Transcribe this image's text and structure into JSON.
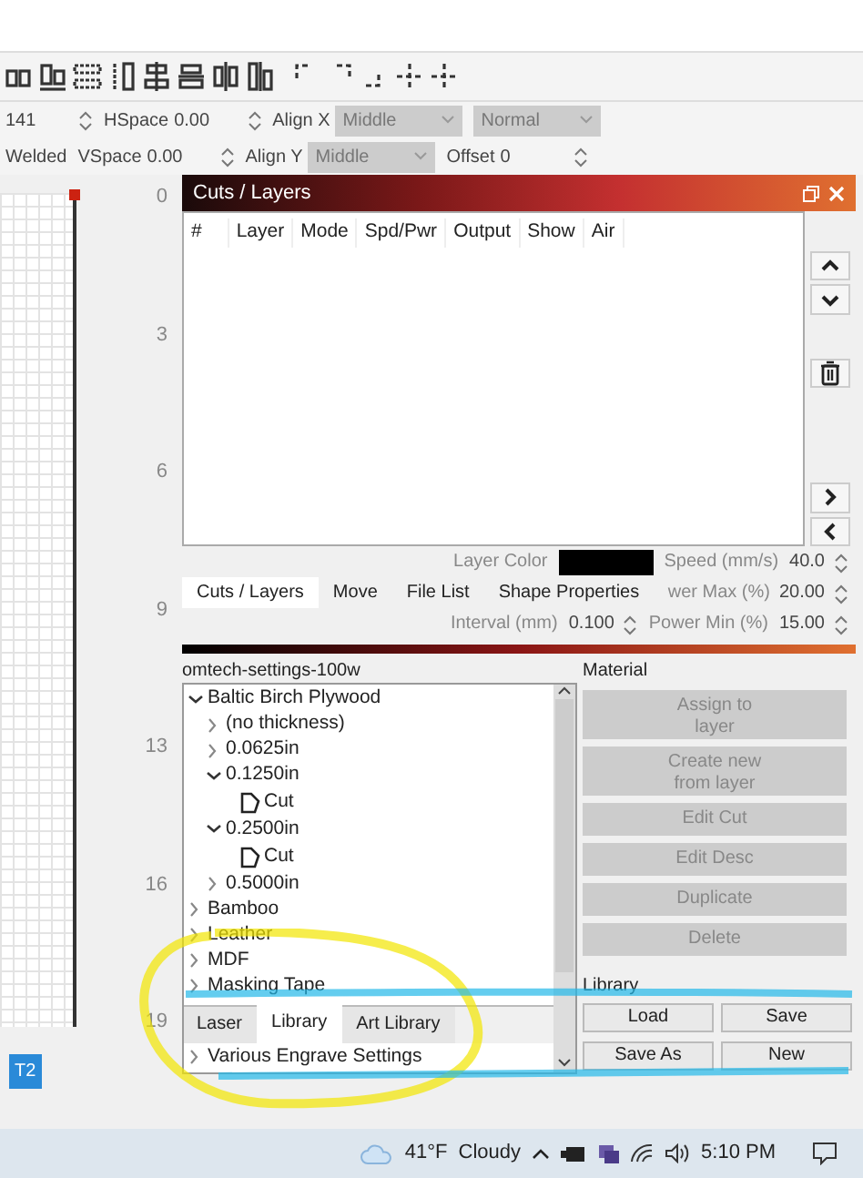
{
  "property_rows": [
    [
      {
        "kind": "spin",
        "value": "141"
      },
      {
        "kind": "spin",
        "label": "HSpace",
        "value": "0.00"
      },
      {
        "kind": "select",
        "label": "Align X",
        "value": "Middle",
        "disabled": true
      },
      {
        "kind": "select",
        "value": "Normal",
        "disabled": true
      }
    ],
    [
      {
        "kind": "text",
        "value": "Welded"
      },
      {
        "kind": "spin",
        "label": "VSpace",
        "value": "0.00"
      },
      {
        "kind": "select",
        "label": "Align Y",
        "value": "Middle",
        "disabled": true
      },
      {
        "kind": "spin",
        "label": "Offset",
        "value": "0"
      }
    ]
  ],
  "ruler": {
    "marks": [
      "0",
      "3",
      "6",
      "9",
      "13",
      "16",
      "19"
    ]
  },
  "canvas_tag": "T2",
  "cuts_layers": {
    "title": "Cuts / Layers",
    "columns": [
      "#",
      "Layer",
      "Mode",
      "Spd/Pwr",
      "Output",
      "Show",
      "Air"
    ],
    "layer_color_label": "Layer Color",
    "speed": {
      "label": "Speed (mm/s)",
      "value": "40.0"
    },
    "power_max": {
      "label": "wer Max (%)",
      "value": "20.00"
    },
    "interval": {
      "label": "Interval (mm)",
      "value": "0.100"
    },
    "power_min": {
      "label": "Power Min (%)",
      "value": "15.00"
    },
    "tabs": [
      {
        "label": "Cuts / Layers",
        "selected": true
      },
      {
        "label": "Move",
        "selected": false
      },
      {
        "label": "File List",
        "selected": false
      },
      {
        "label": "Shape Properties",
        "selected": false
      }
    ]
  },
  "library": {
    "file": "omtech-settings-100w",
    "tree": [
      {
        "kind": "group",
        "label": "Baltic Birch Plywood",
        "expanded": true,
        "children": [
          {
            "kind": "group",
            "label": "(no thickness)",
            "expanded": false
          },
          {
            "kind": "group",
            "label": "0.0625in",
            "expanded": false
          },
          {
            "kind": "group",
            "label": "0.1250in",
            "expanded": true,
            "children": [
              {
                "kind": "entry",
                "label": "Cut"
              }
            ]
          },
          {
            "kind": "group",
            "label": "0.2500in",
            "expanded": true,
            "children": [
              {
                "kind": "entry",
                "label": "Cut"
              }
            ]
          },
          {
            "kind": "group",
            "label": "0.5000in",
            "expanded": false
          }
        ]
      },
      {
        "kind": "group",
        "label": "Bamboo",
        "expanded": false
      },
      {
        "kind": "group",
        "label": "Leather",
        "expanded": false
      },
      {
        "kind": "group",
        "label": "MDF",
        "expanded": false
      },
      {
        "kind": "group",
        "label": "Masking Tape",
        "expanded": false
      },
      {
        "kind": "group",
        "label": "Various Engrave Settings",
        "expanded": false
      }
    ],
    "material": {
      "title": "Material",
      "buttons": [
        {
          "label": "Assign to layer",
          "disabled": true
        },
        {
          "label": "Create new from layer",
          "disabled": true
        },
        {
          "label": "Edit Cut",
          "disabled": true
        },
        {
          "label": "Edit Desc",
          "disabled": true
        },
        {
          "label": "Duplicate",
          "disabled": true
        },
        {
          "label": "Delete",
          "disabled": true
        }
      ]
    },
    "library_box": {
      "title": "Library",
      "buttons": [
        {
          "label": "Load",
          "disabled": false
        },
        {
          "label": "Save",
          "disabled": false
        },
        {
          "label": "Save As",
          "disabled": false
        },
        {
          "label": "New",
          "disabled": false
        }
      ]
    }
  },
  "bottom_tabs": [
    {
      "label": "Laser",
      "selected": false
    },
    {
      "label": "Library",
      "selected": true
    },
    {
      "label": "Art Library",
      "selected": false
    }
  ],
  "taskbar": {
    "temperature": "41°F",
    "weather": "Cloudy",
    "time": "5:10 PM"
  }
}
